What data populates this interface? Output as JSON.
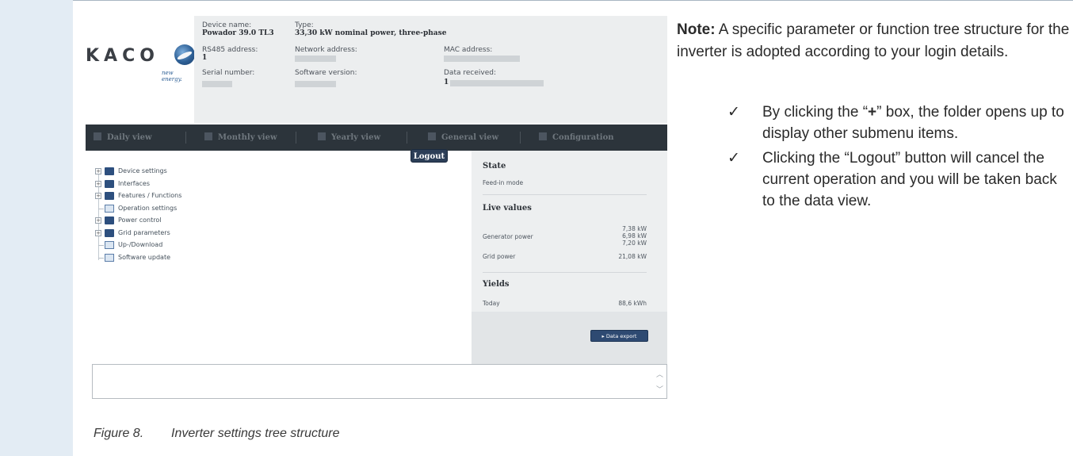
{
  "header": {
    "logo_text": "KACO",
    "logo_tagline": "new energy.",
    "device_name_label": "Device name:",
    "device_name_value": "Powador 39.0 TL3",
    "type_label": "Type:",
    "type_value": "33,30 kW nominal power, three-phase",
    "rs485_label": "RS485 address:",
    "rs485_value": "1",
    "network_label": "Network address:",
    "mac_label": "MAC address:",
    "serial_label": "Serial number:",
    "software_label": "Software version:",
    "data_received_label": "Data received:",
    "data_received_value": "1"
  },
  "nav": {
    "daily": "Daily view",
    "monthly": "Monthly view",
    "yearly": "Yearly view",
    "general": "General view",
    "configuration": "Configuration"
  },
  "tree": {
    "items": [
      {
        "label": "Device settings",
        "kind": "folder"
      },
      {
        "label": "Interfaces",
        "kind": "folder"
      },
      {
        "label": "Features / Functions",
        "kind": "folder"
      },
      {
        "label": "Operation settings",
        "kind": "doc"
      },
      {
        "label": "Power control",
        "kind": "folder"
      },
      {
        "label": "Grid parameters",
        "kind": "folder"
      },
      {
        "label": "Up-/Download",
        "kind": "doc"
      },
      {
        "label": "Software update",
        "kind": "doc"
      }
    ]
  },
  "logout_label": "Logout",
  "side": {
    "state_title": "State",
    "state_value": "Feed-in mode",
    "live_title": "Live values",
    "generator_label": "Generator power",
    "generator_v1": "7,38 kW",
    "generator_v2": "6,98 kW",
    "generator_v3": "7,20 kW",
    "grid_label": "Grid power",
    "grid_value": "21,08 kW",
    "yields_title": "Yields",
    "today_label": "Today",
    "today_value": "88,6 kWh",
    "export_label": "▸ Data export"
  },
  "caption": {
    "number": "Figure 8.",
    "text": "Inverter settings tree structure"
  },
  "note": {
    "lead": "Note:",
    "text": " A specific parameter or function tree structure for the inverter is adopted according to your login details."
  },
  "bullets": [
    {
      "pre": "By clicking the “",
      "strong": "+",
      "post": "” box, the folder opens up to display other submenu items."
    },
    {
      "pre": "Clicking the “Logout” button will cancel the current operation and you will be taken back to the data view.",
      "strong": "",
      "post": ""
    }
  ],
  "colors": {
    "nav_bg": "#2c343b",
    "accent_blue": "#2d4f7e",
    "side_bg": "#edeff0",
    "band": "#e3ecf4"
  }
}
